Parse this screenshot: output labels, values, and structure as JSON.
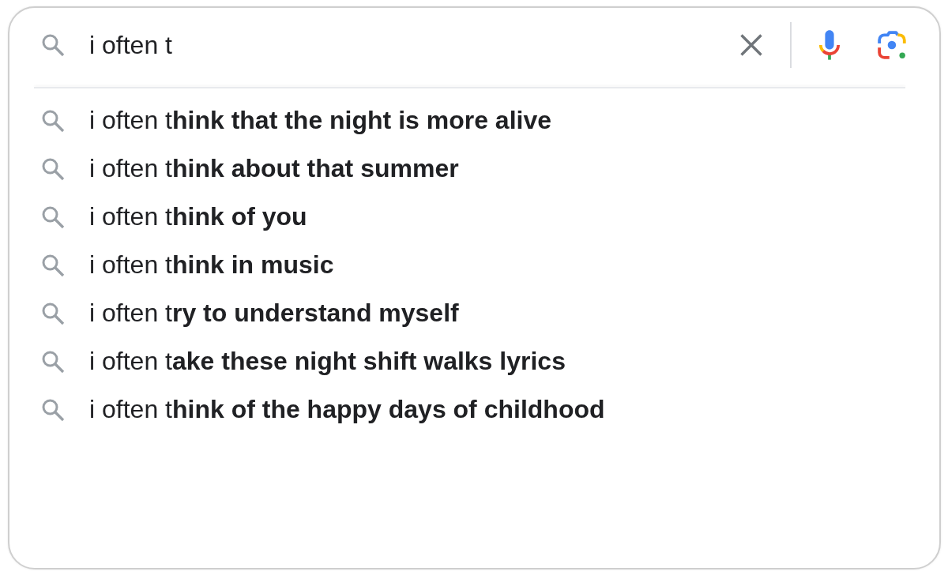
{
  "search": {
    "query": "i often t"
  },
  "suggestions": [
    {
      "text": "i often t**hink that the night is more alive**"
    },
    {
      "text": "i often t**hink about that summer**"
    },
    {
      "text": "i often t**hink of you**"
    },
    {
      "text": "i often t**hink in music**"
    },
    {
      "text": "i often t**ry to understand myself**"
    },
    {
      "text": "i often t**ake these night shift walks lyrics**"
    },
    {
      "text": "i often t**hink of the happy days of childhood**"
    }
  ]
}
